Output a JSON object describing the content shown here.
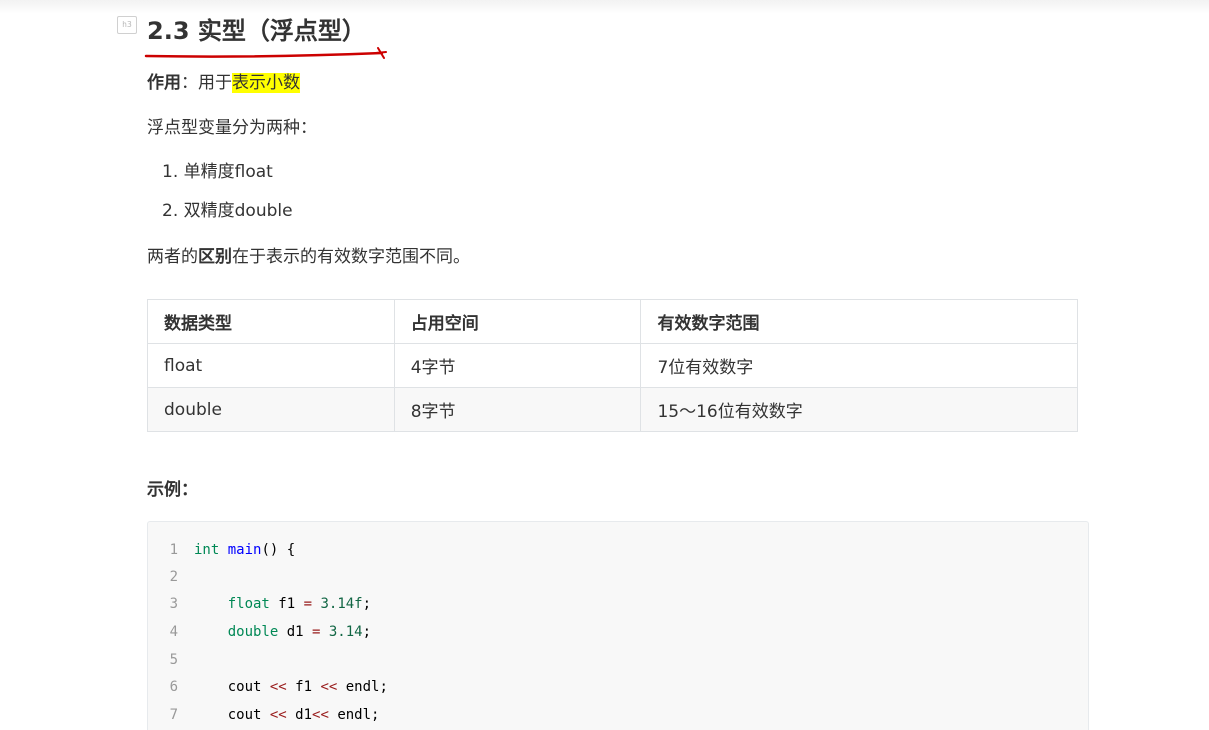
{
  "heading": {
    "badge": "h3",
    "text": "2.3 实型（浮点型）"
  },
  "purpose": {
    "label": "作用",
    "sep": "：用于",
    "highlight": "表示小数"
  },
  "intro": "浮点型变量分为两种：",
  "list": [
    "1. 单精度float",
    "2. 双精度double"
  ],
  "difference": {
    "before": "两者的",
    "bold": "区别",
    "after": "在于表示的有效数字范围不同。"
  },
  "table": {
    "headers": [
      "数据类型",
      "占用空间",
      "有效数字范围"
    ],
    "rows": [
      [
        "float",
        "4字节",
        "7位有效数字"
      ],
      [
        "double",
        "8字节",
        "15～16位有效数字"
      ]
    ]
  },
  "example_label": "示例：",
  "code": {
    "line_numbers": [
      "1",
      "2",
      "3",
      "4",
      "5",
      "6",
      "7"
    ],
    "l1": {
      "type": "int",
      "name": "main",
      "rest": "() {"
    },
    "l3": {
      "type": "float",
      "var": " f1 ",
      "op": "=",
      "num": " 3.14f",
      "end": ";"
    },
    "l4": {
      "type": "double",
      "var": " d1 ",
      "op": "=",
      "num": " 3.14",
      "end": ";"
    },
    "l6": {
      "a": "cout ",
      "op1": "<<",
      "b": " f1 ",
      "op2": "<<",
      "c": " endl;"
    },
    "l7": {
      "a": "cout ",
      "op1": "<<",
      "b": " d1",
      "op2": "<<",
      "c": " endl;"
    }
  },
  "colors": {
    "highlight": "#ffff00",
    "pen_line": "#cc0000",
    "keyword": "#008855",
    "function": "#0000ff",
    "operator": "#981a1a"
  }
}
